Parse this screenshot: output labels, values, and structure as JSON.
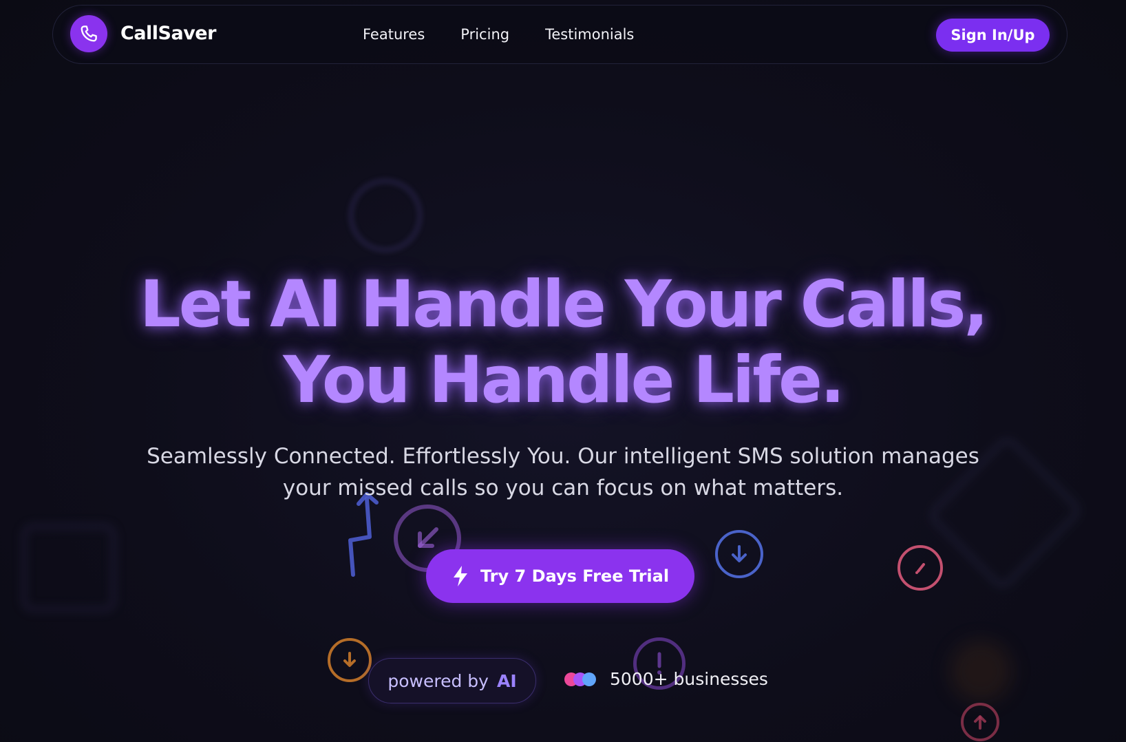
{
  "brand": {
    "name": "CallSaver",
    "logo_icon": "phone-icon",
    "accent_color": "#8a33ee"
  },
  "nav": {
    "links": [
      "Features",
      "Pricing",
      "Testimonials"
    ],
    "signin_label": "Sign In/Up"
  },
  "hero": {
    "headline_line1": "Let AI Handle Your Calls,",
    "headline_line2": "You Handle Life.",
    "subtext": "Seamlessly Connected. Effortlessly You. Our intelligent SMS solution manages your missed calls so you can focus on what matters.",
    "cta_label": "Try 7 Days Free Trial",
    "cta_icon": "lightning-icon",
    "headline_color": "#b487ff"
  },
  "badges": {
    "powered_prefix": "powered by",
    "powered_ai": "AI",
    "businesses": "5000+ businesses",
    "dot_colors": [
      "#ec4899",
      "#a855f7",
      "#60a5fa"
    ]
  }
}
